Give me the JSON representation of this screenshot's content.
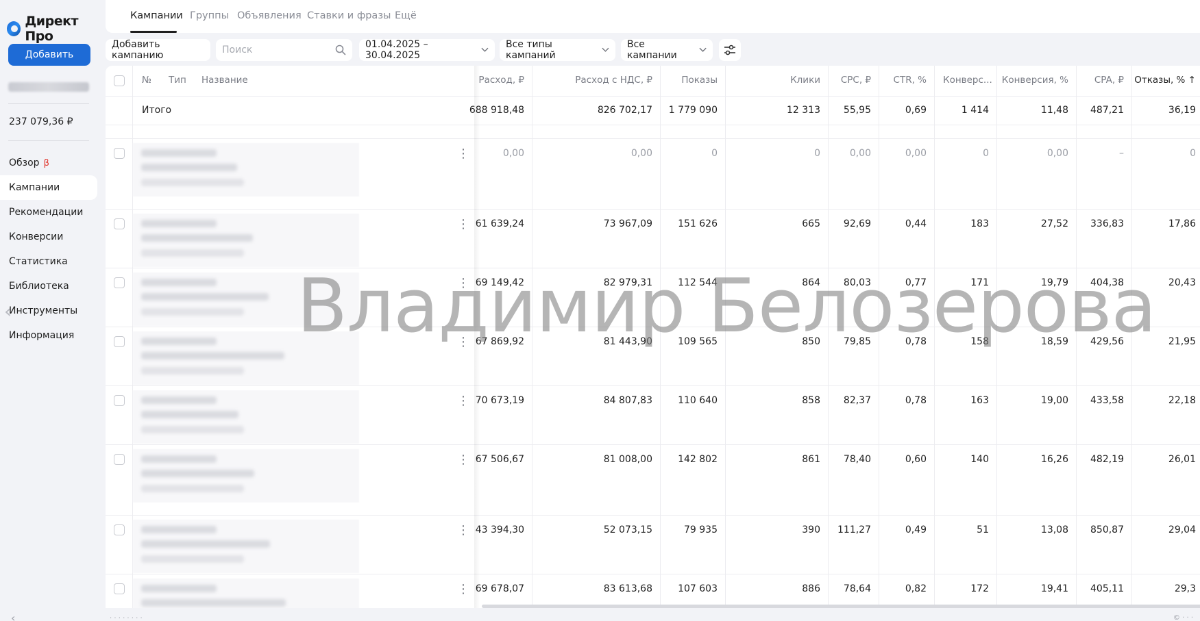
{
  "app": {
    "logo_text": "Директ Про"
  },
  "sidebar": {
    "add_button": "Добавить",
    "balance": "237 079,36 ₽",
    "beta_mark": "β",
    "items": [
      {
        "label": "Обзор"
      },
      {
        "label": "Кампании"
      },
      {
        "label": "Рекомендации"
      },
      {
        "label": "Конверсии"
      },
      {
        "label": "Статистика"
      },
      {
        "label": "Библиотека"
      },
      {
        "label": "Инструменты"
      },
      {
        "label": "Информация"
      }
    ]
  },
  "tabs": [
    "Кампании",
    "Группы",
    "Объявления",
    "Ставки и фразы",
    "Ещё"
  ],
  "toolbar": {
    "add_campaign": "Добавить кампанию",
    "search_placeholder": "Поиск",
    "date_range": "01.04.2025 – 30.04.2025",
    "type_filter": "Все типы кампаний",
    "campaign_filter": "Все кампании"
  },
  "table": {
    "headers": {
      "num": "№",
      "type": "Тип",
      "name": "Название",
      "spend": "Расход, ₽",
      "spend_vat": "Расход с НДС, ₽",
      "impressions": "Показы",
      "clicks": "Клики",
      "cpc": "CPC, ₽",
      "ctr": "CTR, %",
      "conversions": "Конверс...",
      "conv_rate": "Конверсия, %",
      "cpa": "CPA, ₽",
      "bounces": "Отказы, % ↑"
    },
    "total": {
      "label": "Итого",
      "spend": "688 918,48",
      "spend_vat": "826 702,17",
      "impressions": "1 779 090",
      "clicks": "12 313",
      "cpc": "55,95",
      "ctr": "0,69",
      "conversions": "1 414",
      "conv_rate": "11,48",
      "cpa": "487,21",
      "bounces": "36,19"
    },
    "rows": [
      {
        "spend": "0,00",
        "spend_vat": "0,00",
        "impressions": "0",
        "clicks": "0",
        "cpc": "0,00",
        "ctr": "0,00",
        "conversions": "0",
        "conv_rate": "0,00",
        "cpa": "–",
        "bounces": "0"
      },
      {
        "spend": "61 639,24",
        "spend_vat": "73 967,09",
        "impressions": "151 626",
        "clicks": "665",
        "cpc": "92,69",
        "ctr": "0,44",
        "conversions": "183",
        "conv_rate": "27,52",
        "cpa": "336,83",
        "bounces": "17,86"
      },
      {
        "spend": "69 149,42",
        "spend_vat": "82 979,31",
        "impressions": "112 544",
        "clicks": "864",
        "cpc": "80,03",
        "ctr": "0,77",
        "conversions": "171",
        "conv_rate": "19,79",
        "cpa": "404,38",
        "bounces": "20,43"
      },
      {
        "spend": "67 869,92",
        "spend_vat": "81 443,90",
        "impressions": "109 565",
        "clicks": "850",
        "cpc": "79,85",
        "ctr": "0,78",
        "conversions": "158",
        "conv_rate": "18,59",
        "cpa": "429,56",
        "bounces": "21,95"
      },
      {
        "spend": "70 673,19",
        "spend_vat": "84 807,83",
        "impressions": "110 640",
        "clicks": "858",
        "cpc": "82,37",
        "ctr": "0,78",
        "conversions": "163",
        "conv_rate": "19,00",
        "cpa": "433,58",
        "bounces": "22,18"
      },
      {
        "spend": "67 506,67",
        "spend_vat": "81 008,00",
        "impressions": "142 802",
        "clicks": "861",
        "cpc": "78,40",
        "ctr": "0,60",
        "conversions": "140",
        "conv_rate": "16,26",
        "cpa": "482,19",
        "bounces": "26,01"
      },
      {
        "spend": "43 394,30",
        "spend_vat": "52 073,15",
        "impressions": "79 935",
        "clicks": "390",
        "cpc": "111,27",
        "ctr": "0,49",
        "conversions": "51",
        "conv_rate": "13,08",
        "cpa": "850,87",
        "bounces": "29,04"
      },
      {
        "spend": "69 678,07",
        "spend_vat": "83 613,68",
        "impressions": "107 603",
        "clicks": "886",
        "cpc": "78,64",
        "ctr": "0,82",
        "conversions": "172",
        "conv_rate": "19,41",
        "cpa": "405,11",
        "bounces": "29,3"
      }
    ]
  },
  "watermark": "Владимир Белозерова",
  "colors": {
    "accent": "#1e6bd6",
    "beta": "#e0342b"
  }
}
